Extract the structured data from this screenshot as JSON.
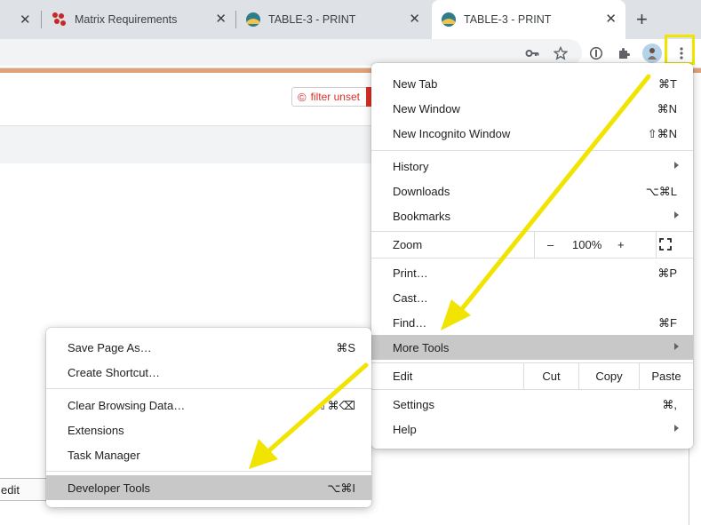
{
  "tabs": [
    {
      "title": "Matrix Requirements",
      "close": "✕"
    },
    {
      "title": "TABLE-3 - PRINT",
      "close": "✕"
    },
    {
      "title": "TABLE-3 - PRINT",
      "close": "✕",
      "active": true
    }
  ],
  "tabstrip": {
    "first_close": "✕",
    "new_tab": "+"
  },
  "toolbar": {
    "icons": [
      "key-icon",
      "star-icon",
      "password-icon",
      "extensions-icon",
      "avatar",
      "menu-icon"
    ]
  },
  "page": {
    "filter_label": "filter unset",
    "filter_icon": "©",
    "edit_label": "edit"
  },
  "menu": {
    "new_tab": {
      "label": "New Tab",
      "shortcut": "⌘T"
    },
    "new_window": {
      "label": "New Window",
      "shortcut": "⌘N"
    },
    "new_incognito": {
      "label": "New Incognito Window",
      "shortcut": "⇧⌘N"
    },
    "history": {
      "label": "History"
    },
    "downloads": {
      "label": "Downloads",
      "shortcut": "⌥⌘L"
    },
    "bookmarks": {
      "label": "Bookmarks"
    },
    "zoom": {
      "label": "Zoom",
      "minus": "–",
      "value": "100%",
      "plus": "+"
    },
    "print": {
      "label": "Print…",
      "shortcut": "⌘P"
    },
    "cast": {
      "label": "Cast…"
    },
    "find": {
      "label": "Find…",
      "shortcut": "⌘F"
    },
    "more_tools": {
      "label": "More Tools"
    },
    "edit": {
      "label": "Edit",
      "cut": "Cut",
      "copy": "Copy",
      "paste": "Paste"
    },
    "settings": {
      "label": "Settings",
      "shortcut": "⌘,"
    },
    "help": {
      "label": "Help"
    }
  },
  "submenu": {
    "save_page": {
      "label": "Save Page As…",
      "shortcut": "⌘S"
    },
    "create_shortcut": {
      "label": "Create Shortcut…"
    },
    "clear_data": {
      "label": "Clear Browsing Data…",
      "shortcut": "⇧⌘⌫"
    },
    "extensions": {
      "label": "Extensions"
    },
    "task_manager": {
      "label": "Task Manager"
    },
    "developer_tools": {
      "label": "Developer Tools",
      "shortcut": "⌥⌘I"
    }
  },
  "colors": {
    "highlight": "#f0e400",
    "menu_hover": "#c8c8c8",
    "filter_red": "#d93025"
  }
}
